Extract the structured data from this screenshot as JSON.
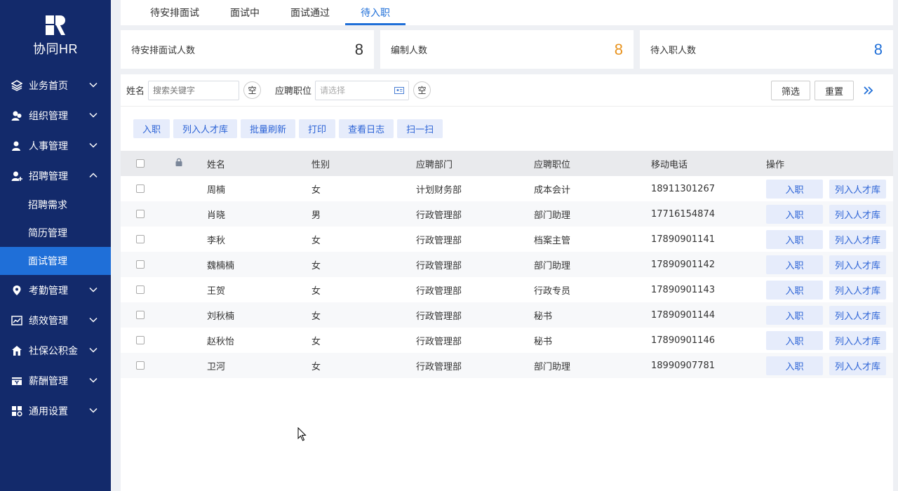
{
  "logo": {
    "text": "协同HR"
  },
  "sidebar": {
    "items": [
      {
        "label": "业务首页",
        "icon": "layers-icon"
      },
      {
        "label": "组织管理",
        "icon": "org-icon"
      },
      {
        "label": "人事管理",
        "icon": "person-icon"
      },
      {
        "label": "招聘管理",
        "icon": "add-person-icon",
        "expanded": true,
        "children": [
          {
            "label": "招聘需求"
          },
          {
            "label": "简历管理"
          },
          {
            "label": "面试管理",
            "active": true
          }
        ]
      },
      {
        "label": "考勤管理",
        "icon": "location-icon"
      },
      {
        "label": "绩效管理",
        "icon": "chart-icon"
      },
      {
        "label": "社保公积金",
        "icon": "house-icon"
      },
      {
        "label": "薪酬管理",
        "icon": "wallet-icon"
      },
      {
        "label": "通用设置",
        "icon": "settings-icon"
      }
    ]
  },
  "tabs": [
    {
      "label": "待安排面试"
    },
    {
      "label": "面试中"
    },
    {
      "label": "面试通过"
    },
    {
      "label": "待入职",
      "active": true
    }
  ],
  "stats": [
    {
      "label": "待安排面试人数",
      "value": "8",
      "color": "#333333"
    },
    {
      "label": "编制人数",
      "value": "8",
      "color": "#e8931e"
    },
    {
      "label": "待入职人数",
      "value": "8",
      "color": "#1f6fd8"
    }
  ],
  "filter": {
    "name_label": "姓名",
    "name_placeholder": "搜索关键字",
    "clear_label": "空",
    "position_label": "应聘职位",
    "position_placeholder": "请选择",
    "filter_btn": "筛选",
    "reset_btn": "重置"
  },
  "actions": [
    "入职",
    "列入人才库",
    "批量刷新",
    "打印",
    "查看日志",
    "扫一扫"
  ],
  "table": {
    "headers": [
      "姓名",
      "性别",
      "应聘部门",
      "应聘职位",
      "移动电话",
      "操作"
    ],
    "row_actions": {
      "onboard": "入职",
      "talent": "列入人才库"
    },
    "rows": [
      {
        "name": "周楠",
        "gender": "女",
        "dept": "计划财务部",
        "position": "成本会计",
        "phone": "18911301267"
      },
      {
        "name": "肖晓",
        "gender": "男",
        "dept": "行政管理部",
        "position": "部门助理",
        "phone": "17716154874"
      },
      {
        "name": "李秋",
        "gender": "女",
        "dept": "行政管理部",
        "position": "档案主管",
        "phone": "17890901141"
      },
      {
        "name": "魏楠楠",
        "gender": "女",
        "dept": "行政管理部",
        "position": "部门助理",
        "phone": "17890901142"
      },
      {
        "name": "王贺",
        "gender": "女",
        "dept": "行政管理部",
        "position": "行政专员",
        "phone": "17890901143"
      },
      {
        "name": "刘秋楠",
        "gender": "女",
        "dept": "行政管理部",
        "position": "秘书",
        "phone": "17890901144"
      },
      {
        "name": "赵秋怡",
        "gender": "女",
        "dept": "行政管理部",
        "position": "秘书",
        "phone": "17890901146"
      },
      {
        "name": "卫河",
        "gender": "女",
        "dept": "行政管理部",
        "position": "部门助理",
        "phone": "18990907781"
      }
    ]
  }
}
